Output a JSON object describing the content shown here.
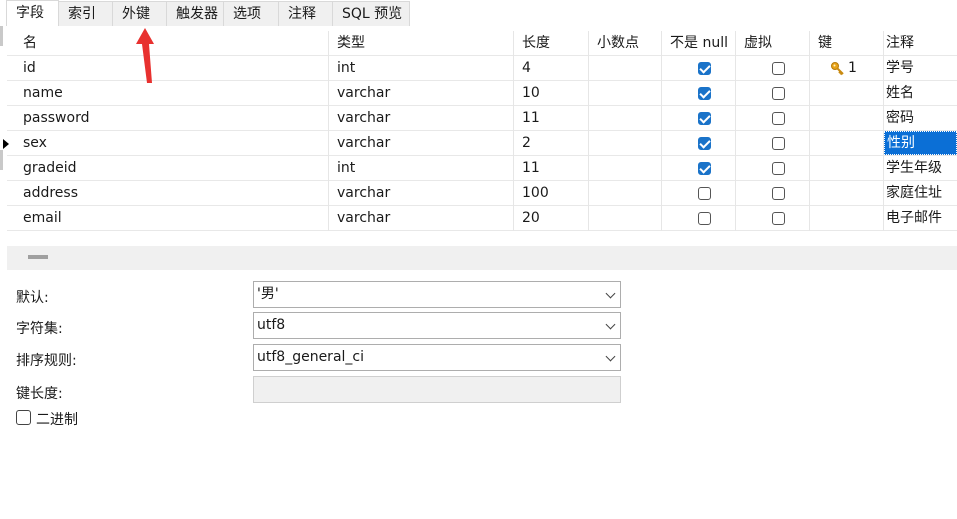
{
  "tabs": [
    {
      "label": "字段",
      "active": true
    },
    {
      "label": "索引"
    },
    {
      "label": "外键"
    },
    {
      "label": "触发器"
    },
    {
      "label": "选项"
    },
    {
      "label": "注释"
    },
    {
      "label": "SQL 预览"
    }
  ],
  "columns": [
    "名",
    "类型",
    "长度",
    "小数点",
    "不是 null",
    "虚拟",
    "键",
    "注释"
  ],
  "rows": [
    {
      "name": "id",
      "type": "int",
      "length": "4",
      "decimal": "",
      "not_null": true,
      "virtual": false,
      "key": "1",
      "comment": "学号"
    },
    {
      "name": "name",
      "type": "varchar",
      "length": "10",
      "decimal": "",
      "not_null": true,
      "virtual": false,
      "key": "",
      "comment": "姓名"
    },
    {
      "name": "password",
      "type": "varchar",
      "length": "11",
      "decimal": "",
      "not_null": true,
      "virtual": false,
      "key": "",
      "comment": "密码"
    },
    {
      "name": "sex",
      "type": "varchar",
      "length": "2",
      "decimal": "",
      "not_null": true,
      "virtual": false,
      "key": "",
      "comment": "性别"
    },
    {
      "name": "gradeid",
      "type": "int",
      "length": "11",
      "decimal": "",
      "not_null": true,
      "virtual": false,
      "key": "",
      "comment": "学生年级"
    },
    {
      "name": "address",
      "type": "varchar",
      "length": "100",
      "decimal": "",
      "not_null": false,
      "virtual": false,
      "key": "",
      "comment": "家庭住址"
    },
    {
      "name": "email",
      "type": "varchar",
      "length": "20",
      "decimal": "",
      "not_null": false,
      "virtual": false,
      "key": "",
      "comment": "电子邮件"
    }
  ],
  "properties": {
    "default_label": "默认:",
    "default_value": "'男'",
    "charset_label": "字符集:",
    "charset_value": "utf8",
    "collation_label": "排序规则:",
    "collation_value": "utf8_general_ci",
    "keylen_label": "键长度:",
    "keylen_value": "",
    "binary_label": "二进制"
  },
  "colors": {
    "accent": "#1a73c9",
    "selection": "#0b6fd6",
    "annotation_arrow": "#e8312f"
  }
}
